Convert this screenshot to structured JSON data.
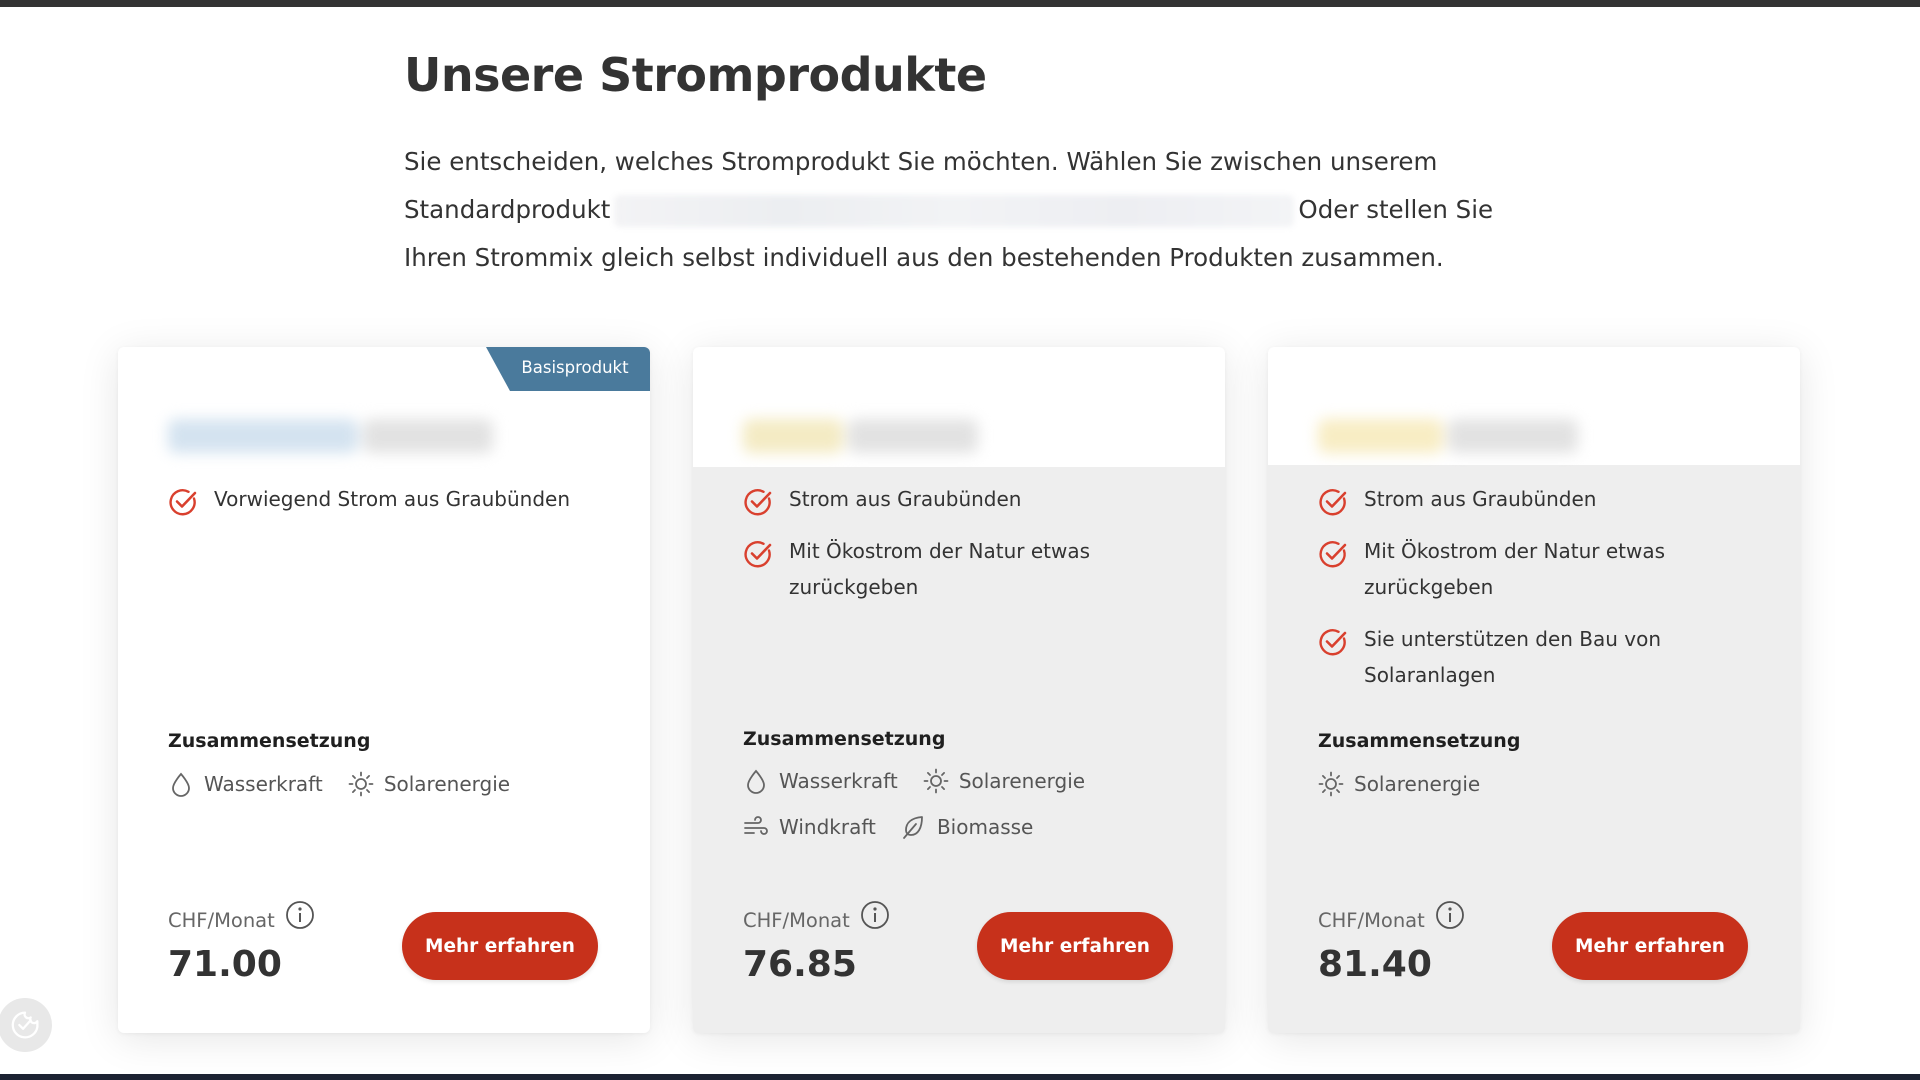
{
  "page": {
    "heading": "Unsere Stromprodukte",
    "intro_part1": "Sie entscheiden, welches Stromprodukt Sie möchten. Wählen Sie zwischen unserem Standardprodukt",
    "intro_part2": "Oder stellen Sie Ihren Strommix gleich selbst individuell aus den bestehenden Produkten zusammen."
  },
  "colors": {
    "accent_red": "#c7311b",
    "badge_blue": "#4a7a9c",
    "check_red": "#d9402e"
  },
  "cards": [
    {
      "badge": "Basisprodukt",
      "features": [
        "Vorwiegend Strom aus Graubünden"
      ],
      "composition_title": "Zusammensetzung",
      "composition": [
        {
          "icon": "water-drop-icon",
          "label": "Wasserkraft"
        },
        {
          "icon": "sun-icon",
          "label": "Solarenergie"
        }
      ],
      "price_label": "CHF/Monat",
      "price": "71.00",
      "button": "Mehr erfahren"
    },
    {
      "features": [
        "Strom aus Graubünden",
        "Mit Ökostrom der Natur etwas zurückgeben"
      ],
      "composition_title": "Zusammensetzung",
      "composition": [
        {
          "icon": "water-drop-icon",
          "label": "Wasserkraft"
        },
        {
          "icon": "sun-icon",
          "label": "Solarenergie"
        },
        {
          "icon": "wind-icon",
          "label": "Windkraft"
        },
        {
          "icon": "leaf-icon",
          "label": "Biomasse"
        }
      ],
      "price_label": "CHF/Monat",
      "price": "76.85",
      "button": "Mehr erfahren"
    },
    {
      "features": [
        "Strom aus Graubünden",
        "Mit Ökostrom der Natur etwas zurückgeben",
        "Sie unterstützen den Bau von Solaranlagen"
      ],
      "composition_title": "Zusammensetzung",
      "composition": [
        {
          "icon": "sun-icon",
          "label": "Solarenergie"
        }
      ],
      "price_label": "CHF/Monat",
      "price": "81.40",
      "button": "Mehr erfahren"
    }
  ]
}
